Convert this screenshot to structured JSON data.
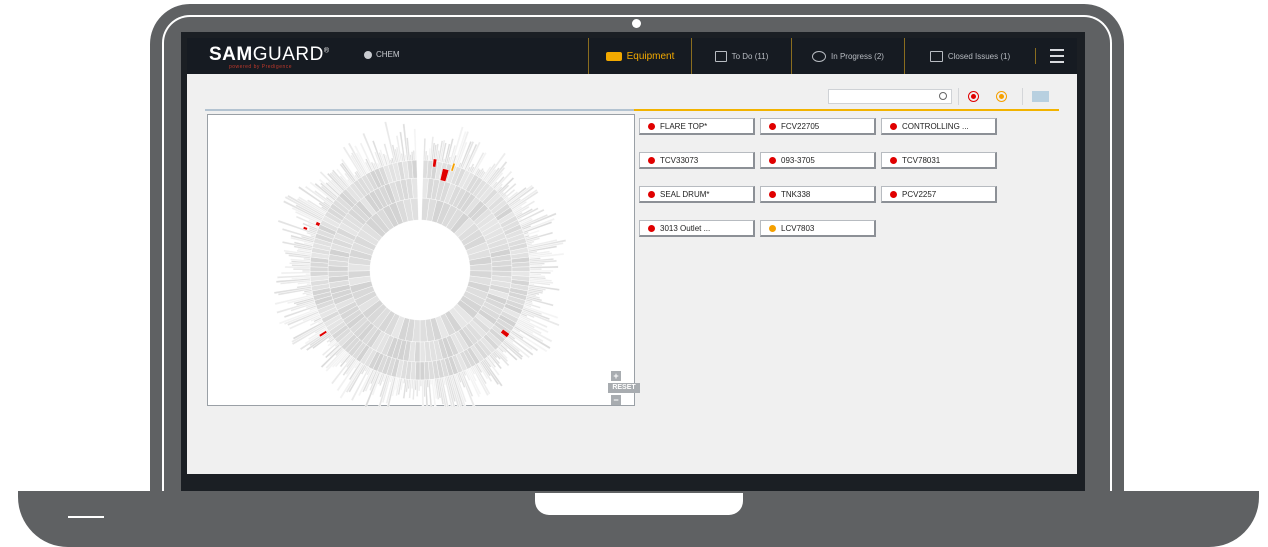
{
  "app": {
    "logo_sam": "SAM",
    "logo_guard": "GUARD",
    "logo_tm": "®",
    "logo_sub": "powered by Predigence",
    "site": "CHEM"
  },
  "nav": {
    "equipment": "Equipment",
    "todo": "To Do (11)",
    "in_progress": "In Progress (2)",
    "closed": "Closed Issues (1)"
  },
  "toolbar": {
    "search_placeholder": ""
  },
  "chart_controls": {
    "zoom_in": "+",
    "reset": "RESET",
    "zoom_out": "−"
  },
  "colors": {
    "accent": "#f2a900",
    "alert_red": "#e00000",
    "warning_orange": "#f5a000",
    "nav_bg": "#161b22"
  },
  "equipment_tags": [
    {
      "label": "FLARE TOP*",
      "status": "red"
    },
    {
      "label": "FCV22705",
      "status": "red"
    },
    {
      "label": "CONTROLLING ...",
      "status": "red"
    },
    {
      "label": "TCV33073",
      "status": "red"
    },
    {
      "label": "093-3705",
      "status": "red"
    },
    {
      "label": "TCV78031",
      "status": "red"
    },
    {
      "label": "SEAL DRUM*",
      "status": "red"
    },
    {
      "label": "TNK338",
      "status": "red"
    },
    {
      "label": "PCV2257",
      "status": "red"
    },
    {
      "label": "3013 Outlet ...",
      "status": "red"
    },
    {
      "label": "LCV7803",
      "status": "orange"
    }
  ]
}
